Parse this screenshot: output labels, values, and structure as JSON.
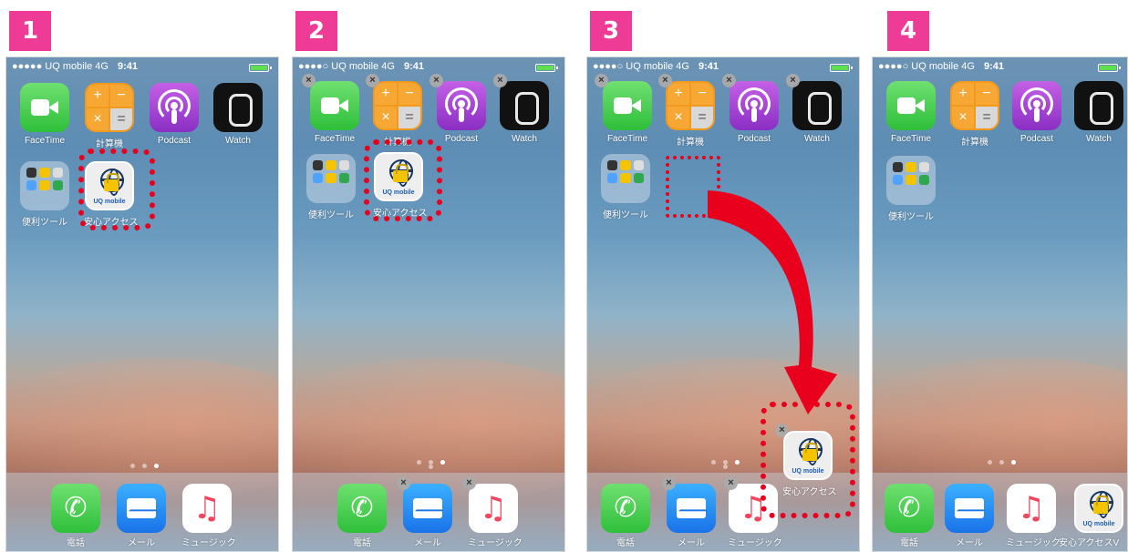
{
  "steps": [
    {
      "number": "1",
      "status": {
        "carrier": "●●●●● UQ mobile  4G",
        "time": "9:41"
      }
    },
    {
      "number": "2",
      "status": {
        "carrier": "●●●●○ UQ mobile  4G",
        "time": "9:41"
      }
    },
    {
      "number": "3",
      "status": {
        "carrier": "●●●●○ UQ mobile  4G",
        "time": "9:41"
      }
    },
    {
      "number": "4",
      "status": {
        "carrier": "●●●●○ UQ mobile  4G",
        "time": "9:41"
      }
    }
  ],
  "apps": {
    "facetime": "FaceTime",
    "calculator": "計算機",
    "podcast": "Podcast",
    "watch": "Watch",
    "folder": "便利ツール",
    "uq_access": "安心アクセス",
    "uq_access_full": "安心アクセスV",
    "uq_logo_text": "UQ mobile",
    "phone": "電話",
    "mail": "メール",
    "music": "ミュージック"
  },
  "delete_glyph": "×",
  "calc_keys": [
    "+",
    "−",
    "×",
    "="
  ],
  "accent_color": "#ee3c96",
  "highlight_color": "#e8001c"
}
